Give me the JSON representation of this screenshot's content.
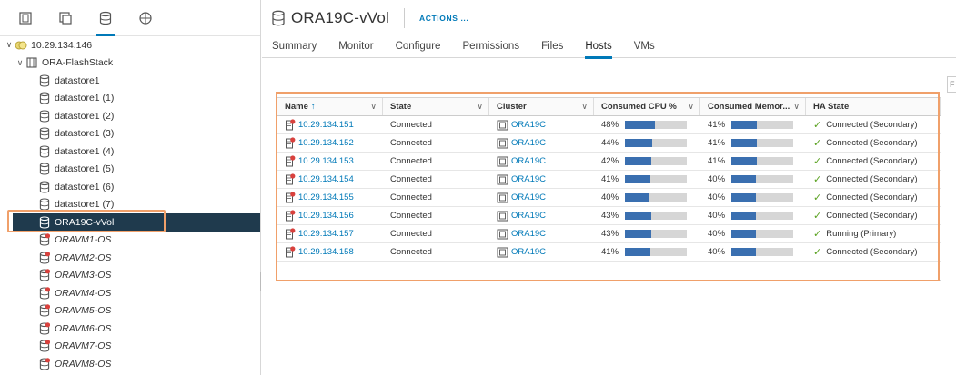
{
  "nav": {
    "tabs": [
      {
        "icon": "hosts-clusters-icon"
      },
      {
        "icon": "vms-templates-icon"
      },
      {
        "icon": "storage-icon",
        "active": true
      },
      {
        "icon": "networking-icon"
      }
    ],
    "tree": [
      {
        "label": "10.29.134.146",
        "indent": 0,
        "caret": "∨",
        "icon": "vcenter-icon",
        "vm": false
      },
      {
        "label": "ORA-FlashStack",
        "indent": 1,
        "caret": "∨",
        "icon": "datacenter-icon",
        "vm": false
      },
      {
        "label": "datastore1",
        "indent": 2,
        "icon": "datastore-icon",
        "vm": false
      },
      {
        "label": "datastore1 (1)",
        "indent": 2,
        "icon": "datastore-icon",
        "vm": false
      },
      {
        "label": "datastore1 (2)",
        "indent": 2,
        "icon": "datastore-icon",
        "vm": false
      },
      {
        "label": "datastore1 (3)",
        "indent": 2,
        "icon": "datastore-icon",
        "vm": false
      },
      {
        "label": "datastore1 (4)",
        "indent": 2,
        "icon": "datastore-icon",
        "vm": false
      },
      {
        "label": "datastore1 (5)",
        "indent": 2,
        "icon": "datastore-icon",
        "vm": false
      },
      {
        "label": "datastore1 (6)",
        "indent": 2,
        "icon": "datastore-icon",
        "vm": false
      },
      {
        "label": "datastore1 (7)",
        "indent": 2,
        "icon": "datastore-icon",
        "vm": false
      },
      {
        "label": "ORA19C-vVol",
        "indent": 2,
        "icon": "datastore-icon",
        "vm": false,
        "selected": true
      },
      {
        "label": "ORAVM1-OS",
        "indent": 2,
        "icon": "datastore-alert-icon",
        "vm": true
      },
      {
        "label": "ORAVM2-OS",
        "indent": 2,
        "icon": "datastore-alert-icon",
        "vm": true
      },
      {
        "label": "ORAVM3-OS",
        "indent": 2,
        "icon": "datastore-alert-icon",
        "vm": true
      },
      {
        "label": "ORAVM4-OS",
        "indent": 2,
        "icon": "datastore-alert-icon",
        "vm": true
      },
      {
        "label": "ORAVM5-OS",
        "indent": 2,
        "icon": "datastore-alert-icon",
        "vm": true
      },
      {
        "label": "ORAVM6-OS",
        "indent": 2,
        "icon": "datastore-alert-icon",
        "vm": true
      },
      {
        "label": "ORAVM7-OS",
        "indent": 2,
        "icon": "datastore-alert-icon",
        "vm": true
      },
      {
        "label": "ORAVM8-OS",
        "indent": 2,
        "icon": "datastore-alert-icon",
        "vm": true
      }
    ]
  },
  "header": {
    "title": "ORA19C-vVol",
    "actions_label": "ACTIONS ..."
  },
  "tabs": [
    "Summary",
    "Monitor",
    "Configure",
    "Permissions",
    "Files",
    "Hosts",
    "VMs"
  ],
  "active_tab": "Hosts",
  "filter_placeholder": "F",
  "grid": {
    "columns": [
      "Name",
      "State",
      "Cluster",
      "Consumed CPU %",
      "Consumed Memor...",
      "HA State"
    ],
    "sort_indicator": "↑",
    "rows": [
      {
        "name": "10.29.134.151",
        "state": "Connected",
        "cluster": "ORA19C",
        "cpu": 48,
        "mem": 41,
        "ha": "Connected (Secondary)"
      },
      {
        "name": "10.29.134.152",
        "state": "Connected",
        "cluster": "ORA19C",
        "cpu": 44,
        "mem": 41,
        "ha": "Connected (Secondary)"
      },
      {
        "name": "10.29.134.153",
        "state": "Connected",
        "cluster": "ORA19C",
        "cpu": 42,
        "mem": 41,
        "ha": "Connected (Secondary)"
      },
      {
        "name": "10.29.134.154",
        "state": "Connected",
        "cluster": "ORA19C",
        "cpu": 41,
        "mem": 40,
        "ha": "Connected (Secondary)"
      },
      {
        "name": "10.29.134.155",
        "state": "Connected",
        "cluster": "ORA19C",
        "cpu": 40,
        "mem": 40,
        "ha": "Connected (Secondary)"
      },
      {
        "name": "10.29.134.156",
        "state": "Connected",
        "cluster": "ORA19C",
        "cpu": 43,
        "mem": 40,
        "ha": "Connected (Secondary)"
      },
      {
        "name": "10.29.134.157",
        "state": "Connected",
        "cluster": "ORA19C",
        "cpu": 43,
        "mem": 40,
        "ha": "Running (Primary)"
      },
      {
        "name": "10.29.134.158",
        "state": "Connected",
        "cluster": "ORA19C",
        "cpu": 41,
        "mem": 40,
        "ha": "Connected (Secondary)"
      }
    ]
  },
  "colors": {
    "accent": "#0079b8",
    "selected_bg": "#1f3a4d",
    "highlight_outline": "#f0a06a",
    "bar_fill": "#3a6fb0",
    "ok_green": "#5aa220",
    "alert_red": "#d9413d"
  }
}
